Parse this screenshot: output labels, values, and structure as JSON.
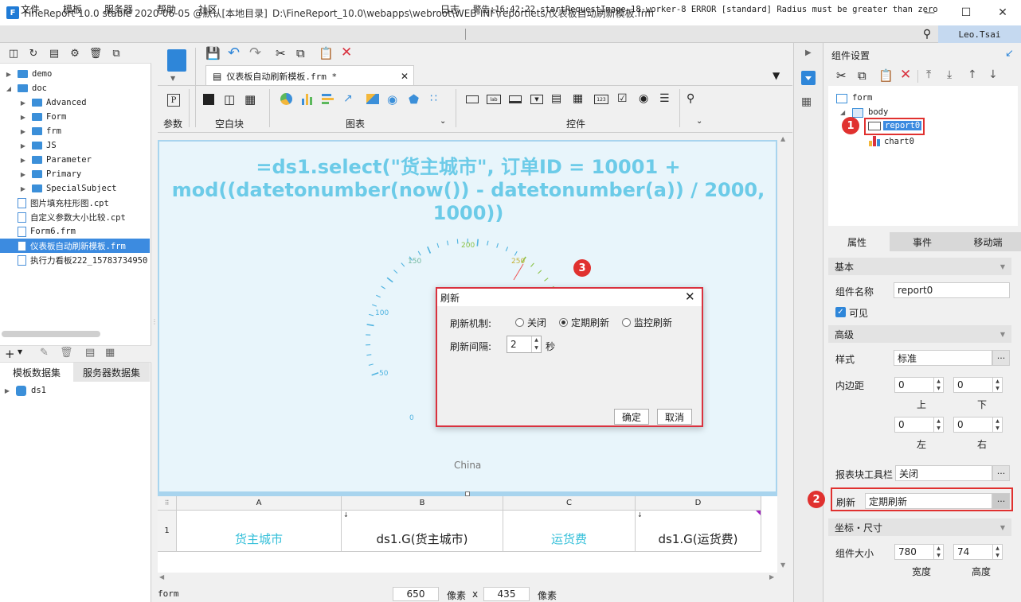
{
  "window": {
    "title": "FineReport 10.0 stable 2020-06-05 @默认[本地目录]",
    "path": "D:\\FineReport_10.0\\webapps\\webroot\\WEB-INF\\reportlets/仪表板自动刷新模板.frm",
    "minimize": "—",
    "maximize": "☐",
    "close": "✕"
  },
  "menu": {
    "items": [
      "文件",
      "模板",
      "服务器",
      "帮助",
      "社区"
    ],
    "log": "日志",
    "warning": "警告:16:42:22 startRequestImage-18-worker-8 ERROR [standard] Radius must be greater than zero",
    "user": "Leo.Tsai"
  },
  "file_tree": [
    {
      "label": "demo",
      "type": "folder",
      "level": 0
    },
    {
      "label": "doc",
      "type": "folder",
      "level": 0
    },
    {
      "label": "Advanced",
      "type": "folder",
      "level": 1
    },
    {
      "label": "Form",
      "type": "folder",
      "level": 1
    },
    {
      "label": "frm",
      "type": "folder",
      "level": 1
    },
    {
      "label": "JS",
      "type": "folder",
      "level": 1
    },
    {
      "label": "Parameter",
      "type": "folder",
      "level": 1
    },
    {
      "label": "Primary",
      "type": "folder",
      "level": 1
    },
    {
      "label": "SpecialSubject",
      "type": "folder",
      "level": 1
    },
    {
      "label": "图片填充柱形图.cpt",
      "type": "file",
      "level": 0
    },
    {
      "label": "自定义参数大小比较.cpt",
      "type": "file",
      "level": 0
    },
    {
      "label": "Form6.frm",
      "type": "file",
      "level": 0
    },
    {
      "label": "仪表板自动刷新模板.frm",
      "type": "file",
      "level": 0,
      "selected": true
    },
    {
      "label": "执行力看板222_15783734950",
      "type": "file",
      "level": 0
    }
  ],
  "dataset_tabs": [
    "模板数据集",
    "服务器数据集"
  ],
  "datasets": [
    "ds1"
  ],
  "doc_tab": "仪表板自动刷新模板.frm *",
  "toolbar_groups": [
    "参数",
    "空白块",
    "图表",
    "控件"
  ],
  "canvas": {
    "formula": "=ds1.select(\"货主城市\", 订单ID = 10001 + mod((datetonumber(now()) - datetonumber(a)) / 2000, 1000))",
    "gauge_ticks": [
      "0",
      "50",
      "100",
      "150",
      "200",
      "250"
    ],
    "gauge_label": "China"
  },
  "grid": {
    "columns": [
      "A",
      "B",
      "C",
      "D"
    ],
    "row_num": "1",
    "cells": [
      "货主城市",
      "ds1.G(货主城市)",
      "运货费",
      "ds1.G(运货费)"
    ]
  },
  "status": {
    "mode": "form",
    "width": "650",
    "unit": "像素",
    "times": "x",
    "height": "435"
  },
  "right_panel": {
    "title": "组件设置",
    "tree": [
      "form",
      "body",
      "report0",
      "chart0"
    ],
    "tabs": [
      "属性",
      "事件",
      "移动端"
    ],
    "basic_header": "基本",
    "name_label": "组件名称",
    "name_value": "report0",
    "visible_label": "可见",
    "advanced_header": "高级",
    "style_label": "样式",
    "style_value": "标准",
    "padding_label": "内边距",
    "padding": {
      "top": "0",
      "bottom": "0",
      "left": "0",
      "right": "0"
    },
    "padding_labels": {
      "top": "上",
      "bottom": "下",
      "left": "左",
      "right": "右"
    },
    "toolbar_label": "报表块工具栏",
    "toolbar_value": "关闭",
    "refresh_label": "刷新",
    "refresh_value": "定期刷新",
    "coord_header": "坐标・尺寸",
    "size_label": "组件大小",
    "width_value": "780",
    "height_value": "74",
    "width_label": "宽度",
    "height_label": "高度"
  },
  "dialog": {
    "title": "刷新",
    "mechanism_label": "刷新机制:",
    "options": [
      "关闭",
      "定期刷新",
      "监控刷新"
    ],
    "selected": "定期刷新",
    "interval_label": "刷新间隔:",
    "interval_value": "2",
    "interval_unit": "秒",
    "ok": "确定",
    "cancel": "取消"
  },
  "badges": [
    "1",
    "2",
    "3"
  ],
  "colors": {
    "accent": "#3c8be0",
    "formula": "#6ccbe8",
    "highlight": "#e0312f"
  }
}
